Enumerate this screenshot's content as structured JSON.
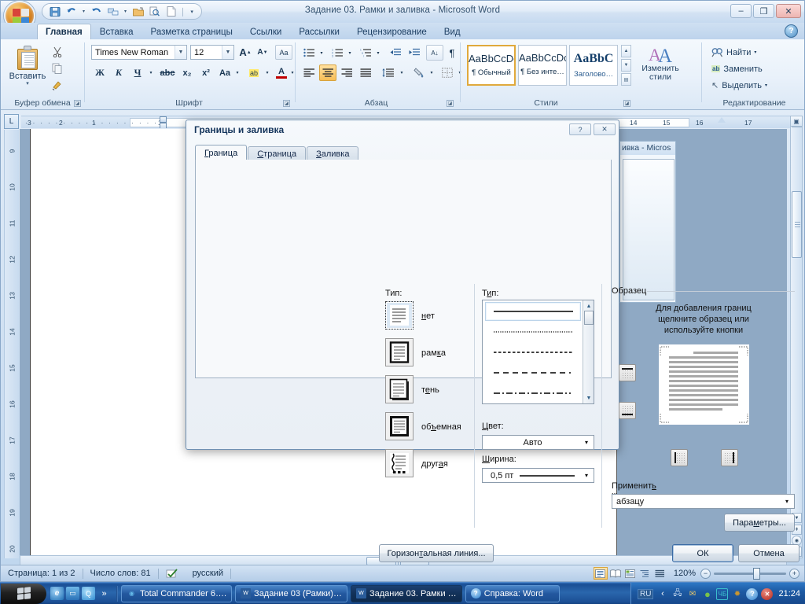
{
  "window": {
    "title": "Задание 03. Рамки и заливка - Microsoft Word",
    "minimize": "–",
    "maximize": "❐",
    "close": "✕",
    "help_icon": "?"
  },
  "quick_access": {
    "office_button": "office-orb",
    "items": [
      {
        "name": "save-icon",
        "glyph": "💾"
      },
      {
        "name": "undo-icon",
        "glyph": "↶"
      },
      {
        "name": "undo-dropdown-icon",
        "glyph": "▾"
      },
      {
        "name": "redo-icon",
        "glyph": "↺"
      },
      {
        "name": "table-icon",
        "glyph": "▦"
      },
      {
        "name": "table-dropdown-icon",
        "glyph": "▾"
      },
      {
        "name": "open-icon",
        "glyph": "📂"
      },
      {
        "name": "print-preview-icon",
        "glyph": "🔍"
      },
      {
        "name": "new-doc-icon",
        "glyph": "📄"
      },
      {
        "name": "customize-qat-icon",
        "glyph": "▾"
      }
    ]
  },
  "ribbon": {
    "tabs": [
      {
        "label": "Главная",
        "active": true
      },
      {
        "label": "Вставка",
        "active": false
      },
      {
        "label": "Разметка страницы",
        "active": false
      },
      {
        "label": "Ссылки",
        "active": false
      },
      {
        "label": "Рассылки",
        "active": false
      },
      {
        "label": "Рецензирование",
        "active": false
      },
      {
        "label": "Вид",
        "active": false
      }
    ],
    "groups": {
      "clipboard": {
        "label": "Буфер обмена",
        "paste_label": "Вставить",
        "paste_arrow": "▾",
        "cut_icon": "✂",
        "copy_icon": "⧉",
        "format_painter_icon": "🖌"
      },
      "font": {
        "label": "Шрифт",
        "font_name": "Times New Roman",
        "font_size": "12",
        "grow_font": "A",
        "shrink_font": "A",
        "clear_format": "Aa",
        "bold": "Ж",
        "italic": "К",
        "underline": "Ч",
        "underline_arrow": "▾",
        "strikethrough": "abc",
        "subscript": "x₂",
        "superscript": "x²",
        "change_case": "Aa",
        "change_case_arrow": "▾",
        "highlight": "ab",
        "highlight_arrow": "▾",
        "font_color": "A",
        "font_color_arrow": "▾"
      },
      "paragraph": {
        "label": "Абзац",
        "bullets": "⋮≡",
        "numbering": "≡",
        "multilevel": "≡",
        "decrease_indent": "⇤",
        "increase_indent": "⇥",
        "sort": "A↓",
        "show_marks": "¶",
        "align_left": "≡",
        "align_center": "≡",
        "align_right": "≡",
        "justify": "≡",
        "line_spacing": "↕≡",
        "shading": "▨",
        "borders": "⊞",
        "dropdown": "▾"
      },
      "styles": {
        "label": "Стили",
        "gallery": [
          {
            "sample": "AaBbCcDc",
            "name": "¶ Обычный",
            "selected": true,
            "big": false
          },
          {
            "sample": "AaBbCcDc",
            "name": "¶ Без инте…",
            "selected": false,
            "big": false
          },
          {
            "sample": "AaBbC",
            "name": "Заголово…",
            "selected": false,
            "big": true
          }
        ],
        "nav_up": "▲",
        "nav_down": "▼",
        "nav_more": "▤",
        "change_styles_label": "Изменить",
        "change_styles_label2": "стили",
        "change_styles_arrow": "▾"
      },
      "editing": {
        "label": "Редактирование",
        "items": [
          {
            "icon": "find-icon",
            "glyph": "🔎",
            "label": "Найти",
            "arrow": "▾"
          },
          {
            "icon": "replace-icon",
            "glyph": "ab",
            "label": "Заменить",
            "arrow": ""
          },
          {
            "icon": "select-icon",
            "glyph": "↖",
            "label": "Выделить",
            "arrow": "▾"
          }
        ]
      }
    }
  },
  "rulers": {
    "horizontal_ticks": [
      "3",
      "2",
      "1",
      "1",
      "14",
      "15",
      "16",
      "17"
    ],
    "vertical_ticks": [
      "9",
      "10",
      "11",
      "12",
      "13",
      "14",
      "15",
      "16",
      "17",
      "18",
      "19",
      "20"
    ],
    "tab_selector_icon": "L"
  },
  "background_window": {
    "title": "ивка - Micros"
  },
  "dialog": {
    "title": "Границы и заливка",
    "help_btn": "?",
    "close_btn": "✕",
    "tabs": [
      {
        "label": "Граница",
        "active": true
      },
      {
        "label": "Страница",
        "active": false
      },
      {
        "label": "Заливка",
        "active": false
      }
    ],
    "type_section": {
      "label": "Тип:",
      "options": [
        {
          "name": "нет",
          "selected": true
        },
        {
          "name": "рамка",
          "selected": false
        },
        {
          "name": "тень",
          "selected": false
        },
        {
          "name": "объемная",
          "selected": false
        },
        {
          "name": "другая",
          "selected": false
        }
      ]
    },
    "style_section": {
      "label": "Тип:",
      "styles": [
        "solid",
        "dotted",
        "dashed-small",
        "dashed-medium",
        "dash-dot"
      ],
      "selected_index": 0,
      "scroll_up": "▲",
      "scroll_down": "▼"
    },
    "color": {
      "label": "Цвет:",
      "value": "Авто",
      "arrow": "▾"
    },
    "width": {
      "label": "Ширина:",
      "value": "0,5 пт",
      "arrow": "▾"
    },
    "preview": {
      "label": "Образец",
      "hint_line1": "Для добавления границ",
      "hint_line2": "щелкните образец или",
      "hint_line3": "используйте кнопки",
      "buttons": [
        {
          "name": "top-border-button"
        },
        {
          "name": "bottom-border-button"
        },
        {
          "name": "left-border-button"
        },
        {
          "name": "right-border-button"
        }
      ]
    },
    "apply_to": {
      "label": "Применить к:",
      "value": "абзацу",
      "arrow": "▾"
    },
    "buttons": {
      "options": "Параметры...",
      "horizontal_line": "Горизонтальная линия...",
      "ok": "ОК",
      "cancel": "Отмена"
    }
  },
  "status_bar": {
    "page": "Страница: 1 из 2",
    "words": "Число слов: 81",
    "proof_icon": "✓",
    "language": "русский",
    "views": [
      {
        "name": "print-layout-view",
        "glyph": "▤",
        "active": true
      },
      {
        "name": "full-screen-reading-view",
        "glyph": "📖",
        "active": false
      },
      {
        "name": "web-layout-view",
        "glyph": "▣",
        "active": false
      },
      {
        "name": "outline-view",
        "glyph": "⇶",
        "active": false
      },
      {
        "name": "draft-view",
        "glyph": "▥",
        "active": false
      }
    ],
    "zoom": "120%",
    "zoom_out": "−",
    "zoom_in": "+"
  },
  "taskbar": {
    "start_label": "",
    "quick_launch": [
      {
        "name": "internet-explorer-icon",
        "glyph": "e",
        "color": "#1f7ac4"
      },
      {
        "name": "show-desktop-icon",
        "glyph": "▭",
        "color": "#2f8fd0"
      },
      {
        "name": "search-icon",
        "glyph": "Q",
        "color": "#3da2de"
      },
      {
        "name": "more-icon",
        "glyph": "»",
        "color": "#ffffff"
      }
    ],
    "items": [
      {
        "label": "Total Commander 6….",
        "icon": "total-commander-icon",
        "glyph": "◉",
        "active": false
      },
      {
        "label": "Задание 03 (Рамки)…",
        "icon": "word-doc-icon",
        "glyph": "W",
        "active": false
      },
      {
        "label": "Задание 03. Рамки …",
        "icon": "word-doc-icon",
        "glyph": "W",
        "active": true
      },
      {
        "label": "Справка: Word",
        "icon": "help-icon",
        "glyph": "?",
        "active": false
      }
    ],
    "tray": [
      {
        "name": "language-indicator",
        "glyph": "RU",
        "color": "#cfe2f7"
      },
      {
        "name": "tray-expand-icon",
        "glyph": "‹",
        "color": "#ffffff"
      },
      {
        "name": "network-icon",
        "glyph": "🖧",
        "color": "#d6e6f7"
      },
      {
        "name": "mail-icon",
        "glyph": "✉",
        "color": "#e8c86a"
      },
      {
        "name": "shield-green-icon",
        "glyph": "●",
        "color": "#79c24a"
      },
      {
        "name": "clipboard-icon",
        "glyph": "ЧБ",
        "color": "#3bbfcf"
      },
      {
        "name": "antivirus-icon",
        "glyph": "✹",
        "color": "#c9952f"
      },
      {
        "name": "help-tray-icon",
        "glyph": "?",
        "color": "#2f82d0"
      },
      {
        "name": "alert-icon",
        "glyph": "✕",
        "color": "#c9362b"
      }
    ],
    "clock": "21:24"
  }
}
